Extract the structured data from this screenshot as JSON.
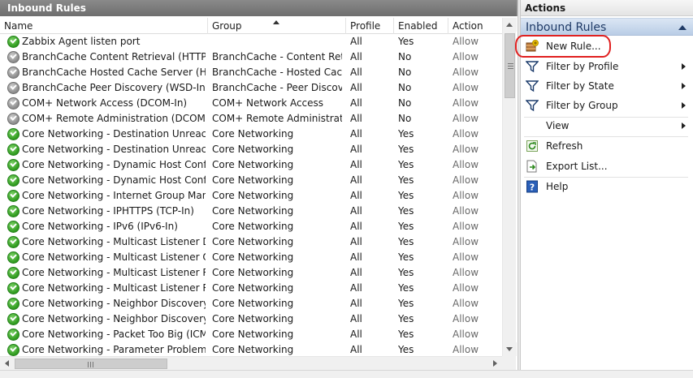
{
  "left_pane": {
    "title": "Inbound Rules",
    "columns": {
      "name": "Name",
      "group": "Group",
      "profile": "Profile",
      "enabled": "Enabled",
      "action": "Action"
    },
    "sort_column": "Group",
    "rows": [
      {
        "status": "enabled",
        "name": "Zabbix Agent listen port",
        "group": "",
        "profile": "All",
        "enabled": "Yes",
        "action": "Allow"
      },
      {
        "status": "disabled",
        "name": "BranchCache Content Retrieval (HTTP-In)",
        "group": "BranchCache - Content Retr...",
        "profile": "All",
        "enabled": "No",
        "action": "Allow"
      },
      {
        "status": "disabled",
        "name": "BranchCache Hosted Cache Server (HTT...",
        "group": "BranchCache - Hosted Cach...",
        "profile": "All",
        "enabled": "No",
        "action": "Allow"
      },
      {
        "status": "disabled",
        "name": "BranchCache Peer Discovery (WSD-In)",
        "group": "BranchCache - Peer Discove...",
        "profile": "All",
        "enabled": "No",
        "action": "Allow"
      },
      {
        "status": "disabled",
        "name": "COM+ Network Access (DCOM-In)",
        "group": "COM+ Network Access",
        "profile": "All",
        "enabled": "No",
        "action": "Allow"
      },
      {
        "status": "disabled",
        "name": "COM+ Remote Administration (DCOM-In)",
        "group": "COM+ Remote Administrati...",
        "profile": "All",
        "enabled": "No",
        "action": "Allow"
      },
      {
        "status": "enabled",
        "name": "Core Networking - Destination Unreacha...",
        "group": "Core Networking",
        "profile": "All",
        "enabled": "Yes",
        "action": "Allow"
      },
      {
        "status": "enabled",
        "name": "Core Networking - Destination Unreacha...",
        "group": "Core Networking",
        "profile": "All",
        "enabled": "Yes",
        "action": "Allow"
      },
      {
        "status": "enabled",
        "name": "Core Networking - Dynamic Host Config...",
        "group": "Core Networking",
        "profile": "All",
        "enabled": "Yes",
        "action": "Allow"
      },
      {
        "status": "enabled",
        "name": "Core Networking - Dynamic Host Config...",
        "group": "Core Networking",
        "profile": "All",
        "enabled": "Yes",
        "action": "Allow"
      },
      {
        "status": "enabled",
        "name": "Core Networking - Internet Group Mana...",
        "group": "Core Networking",
        "profile": "All",
        "enabled": "Yes",
        "action": "Allow"
      },
      {
        "status": "enabled",
        "name": "Core Networking - IPHTTPS (TCP-In)",
        "group": "Core Networking",
        "profile": "All",
        "enabled": "Yes",
        "action": "Allow"
      },
      {
        "status": "enabled",
        "name": "Core Networking - IPv6 (IPv6-In)",
        "group": "Core Networking",
        "profile": "All",
        "enabled": "Yes",
        "action": "Allow"
      },
      {
        "status": "enabled",
        "name": "Core Networking - Multicast Listener Do...",
        "group": "Core Networking",
        "profile": "All",
        "enabled": "Yes",
        "action": "Allow"
      },
      {
        "status": "enabled",
        "name": "Core Networking - Multicast Listener Qu...",
        "group": "Core Networking",
        "profile": "All",
        "enabled": "Yes",
        "action": "Allow"
      },
      {
        "status": "enabled",
        "name": "Core Networking - Multicast Listener Rep...",
        "group": "Core Networking",
        "profile": "All",
        "enabled": "Yes",
        "action": "Allow"
      },
      {
        "status": "enabled",
        "name": "Core Networking - Multicast Listener Rep...",
        "group": "Core Networking",
        "profile": "All",
        "enabled": "Yes",
        "action": "Allow"
      },
      {
        "status": "enabled",
        "name": "Core Networking - Neighbor Discovery A...",
        "group": "Core Networking",
        "profile": "All",
        "enabled": "Yes",
        "action": "Allow"
      },
      {
        "status": "enabled",
        "name": "Core Networking - Neighbor Discovery S...",
        "group": "Core Networking",
        "profile": "All",
        "enabled": "Yes",
        "action": "Allow"
      },
      {
        "status": "enabled",
        "name": "Core Networking - Packet Too Big (ICMP...",
        "group": "Core Networking",
        "profile": "All",
        "enabled": "Yes",
        "action": "Allow"
      },
      {
        "status": "enabled",
        "name": "Core Networking - Parameter Problem (I...",
        "group": "Core Networking",
        "profile": "All",
        "enabled": "Yes",
        "action": "Allow"
      }
    ]
  },
  "actions_pane": {
    "title": "Actions",
    "section": "Inbound Rules",
    "items": [
      {
        "label": "New Rule...",
        "icon": "new-rule-icon",
        "submenu": false
      },
      {
        "label": "Filter by Profile",
        "icon": "filter-icon",
        "submenu": true
      },
      {
        "label": "Filter by State",
        "icon": "filter-icon",
        "submenu": true
      },
      {
        "label": "Filter by Group",
        "icon": "filter-icon",
        "submenu": true
      },
      {
        "label": "View",
        "icon": "",
        "submenu": true
      },
      {
        "label": "Refresh",
        "icon": "refresh-icon",
        "submenu": false
      },
      {
        "label": "Export List...",
        "icon": "export-icon",
        "submenu": false
      },
      {
        "label": "Help",
        "icon": "help-icon",
        "submenu": false
      }
    ]
  },
  "colors": {
    "title_bar": "#6e6e6e",
    "section_head": "#b9cde6",
    "enabled_icon": "#2e9a1d",
    "disabled_icon": "#8a8a8a",
    "highlight": "#e02020"
  }
}
